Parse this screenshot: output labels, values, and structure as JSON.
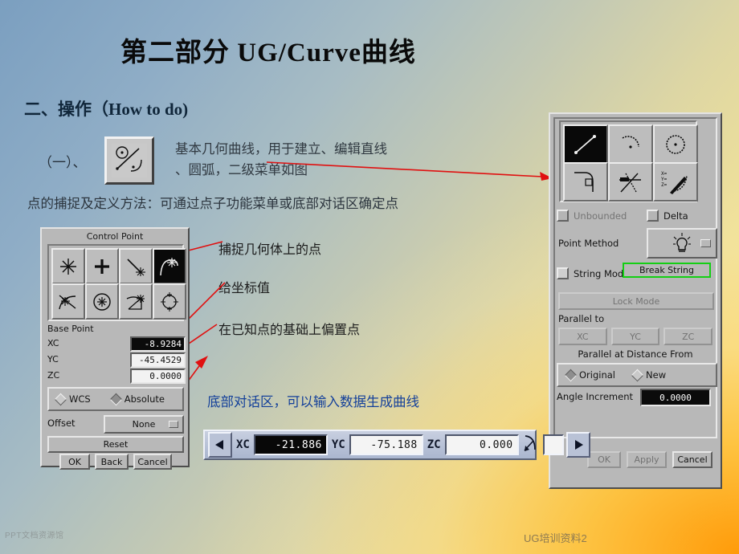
{
  "slide": {
    "title": "第二部分  UG/Curve曲线",
    "heading2": "二、操作（How to do)",
    "sub_label": "（一）、",
    "desc_line1": "基本几何曲线，用于建立、编辑直线",
    "desc_line2": "、圆弧，二级菜单如图",
    "snap_note": "点的捕捉及定义方法：可通过点子功能菜单或底部对话区确定点",
    "annotation_1": "捕捉几何体上的点",
    "annotation_2": "给坐标值",
    "annotation_3": "在已知点的基础上偏置点",
    "blue_note": "底部对话区，可以输入数据生成曲线",
    "footer_right": "UG培训资料2",
    "watermark": "PPT文档资源馆",
    "accent_red": "#e01010",
    "accent_green": "#14cf14",
    "accent_blue": "#14409a"
  },
  "control_point_dialog": {
    "title": "Control Point",
    "icons": [
      {
        "name": "snap-point-asterisk",
        "selected": false
      },
      {
        "name": "snap-point-cross",
        "selected": false
      },
      {
        "name": "snap-endpoint-line",
        "selected": false
      },
      {
        "name": "snap-point-on-curve",
        "selected": true
      },
      {
        "name": "snap-intersection",
        "selected": false
      },
      {
        "name": "snap-arc-center",
        "selected": false
      },
      {
        "name": "snap-quadrant-tangent",
        "selected": false
      },
      {
        "name": "snap-all-quadrants",
        "selected": false
      }
    ],
    "base_point_label": "Base Point",
    "fields": [
      {
        "label": "XC",
        "value": "-8.9284",
        "selected": true
      },
      {
        "label": "YC",
        "value": "-45.4529",
        "selected": false
      },
      {
        "label": "ZC",
        "value": "0.0000",
        "selected": false
      }
    ],
    "coord_system": [
      {
        "label": "WCS",
        "checked": false
      },
      {
        "label": "Absolute",
        "checked": true
      }
    ],
    "offset_label": "Offset",
    "offset_value": "None",
    "reset_label": "Reset",
    "buttons": [
      "OK",
      "Back",
      "Cancel"
    ]
  },
  "curve_dialog": {
    "icons": [
      {
        "name": "line-icon",
        "selected": true
      },
      {
        "name": "arc-icon",
        "selected": false
      },
      {
        "name": "circle-icon",
        "selected": false
      },
      {
        "name": "fillet-icon",
        "selected": false
      },
      {
        "name": "trim-curve-icon",
        "selected": false
      },
      {
        "name": "edit-curve-parameters-icon",
        "selected": false
      }
    ],
    "checkboxes": [
      {
        "label": "Unbounded",
        "checked": false,
        "enabled": false
      },
      {
        "label": "Delta",
        "checked": false,
        "enabled": true
      }
    ],
    "point_method_label": "Point Method",
    "point_method_icon": "inferred-point-icon",
    "string_mode_label": "String Mode",
    "break_string_label": "Break String",
    "lock_mode_label": "Lock Mode",
    "parallel_to_label": "Parallel to",
    "axis_buttons": [
      "XC",
      "YC",
      "ZC"
    ],
    "parallel_distance_label": "Parallel at Distance From",
    "radios": [
      {
        "label": "Original",
        "checked": true
      },
      {
        "label": "New",
        "checked": false
      }
    ],
    "angle_increment_label": "Angle Increment",
    "angle_increment_value": "0.0000",
    "buttons": [
      {
        "label": "OK",
        "enabled": false
      },
      {
        "label": "Apply",
        "enabled": false
      },
      {
        "label": "Cancel",
        "enabled": true
      }
    ]
  },
  "coordinate_bar": {
    "prev_icon": "arrow-left-icon",
    "next_icon": "arrow-right-icon",
    "fields": [
      {
        "label": "XC",
        "value": "-21.886",
        "selected": true
      },
      {
        "label": "YC",
        "value": "-75.188",
        "selected": false
      },
      {
        "label": "ZC",
        "value": "0.000",
        "selected": false
      }
    ],
    "pick_icon": "point-pick-icon"
  }
}
